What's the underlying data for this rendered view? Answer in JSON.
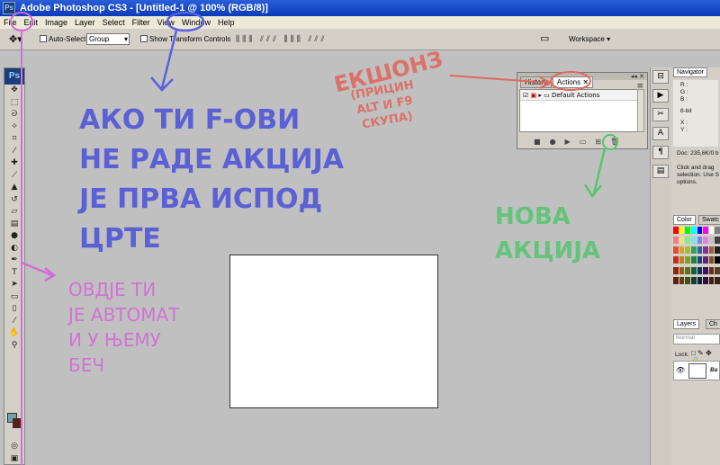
{
  "window": {
    "title": "Adobe Photoshop CS3 - [Untitled-1 @ 100% (RGB/8)]",
    "app_icon": "Ps"
  },
  "menu": [
    "File",
    "Edit",
    "Image",
    "Layer",
    "Select",
    "Filter",
    "View",
    "Window",
    "Help"
  ],
  "options": {
    "auto_select_label": "Auto-Select:",
    "auto_select_value": "Group",
    "show_transform_label": "Show Transform Controls",
    "workspace_label": "Workspace"
  },
  "tools": {
    "logo": "Ps",
    "icons": [
      "move-icon",
      "marquee-icon",
      "lasso-icon",
      "magic-wand-icon",
      "crop-icon",
      "eyedropper-icon",
      "healing-icon",
      "brush-icon",
      "stamp-icon",
      "history-brush-icon",
      "eraser-icon",
      "gradient-icon",
      "blur-icon",
      "dodge-icon",
      "pen-icon",
      "type-icon",
      "path-select-icon",
      "shape-icon",
      "notes-icon",
      "eyedropper2-icon",
      "hand-icon",
      "zoom-icon"
    ]
  },
  "actions_panel": {
    "tabs": [
      "History",
      "Actions"
    ],
    "active_tab": "Actions",
    "rows": [
      "Default Actions"
    ]
  },
  "right_panels": {
    "navigator_tab": "Navigator",
    "info": {
      "r": "R :",
      "g": "G :",
      "b": "B :",
      "bit": "8-bit",
      "x": "X :",
      "y": "Y :",
      "doc": "Doc: 235,6K/0 b",
      "hint": "Click and drag selection. Use S options."
    },
    "color_tabs": [
      "Color",
      "Swatc"
    ],
    "layers_tabs": [
      "Layers",
      "Ch"
    ],
    "blend_mode": "Normal",
    "lock_label": "Lock:",
    "layer_name": "Ba"
  },
  "annotations": {
    "main_text": [
      "АКО ТИ F-ОВИ",
      "НЕ РАДЕ АКЦИЈА",
      "ЈЕ ПРВА ИСПОД",
      "ЦРТЕ"
    ],
    "exons": "ЕКШОНЗ",
    "exons_sub": [
      "(ПРИЦИН",
      "ALT И F9",
      "СКУПА)"
    ],
    "new_action": [
      "НОВА",
      "АКЦИЈА"
    ],
    "pink_text": [
      "ОВДЈЕ ТИ",
      "ЈЕ АВТОМАТ",
      "И У ЊЕМУ",
      "БЕЧ"
    ]
  },
  "colors": {
    "blue": "#4a50d8",
    "pink": "#d46ad8",
    "red": "#e0645a",
    "green": "#55c56f",
    "magenta_line": "#d070e0"
  }
}
